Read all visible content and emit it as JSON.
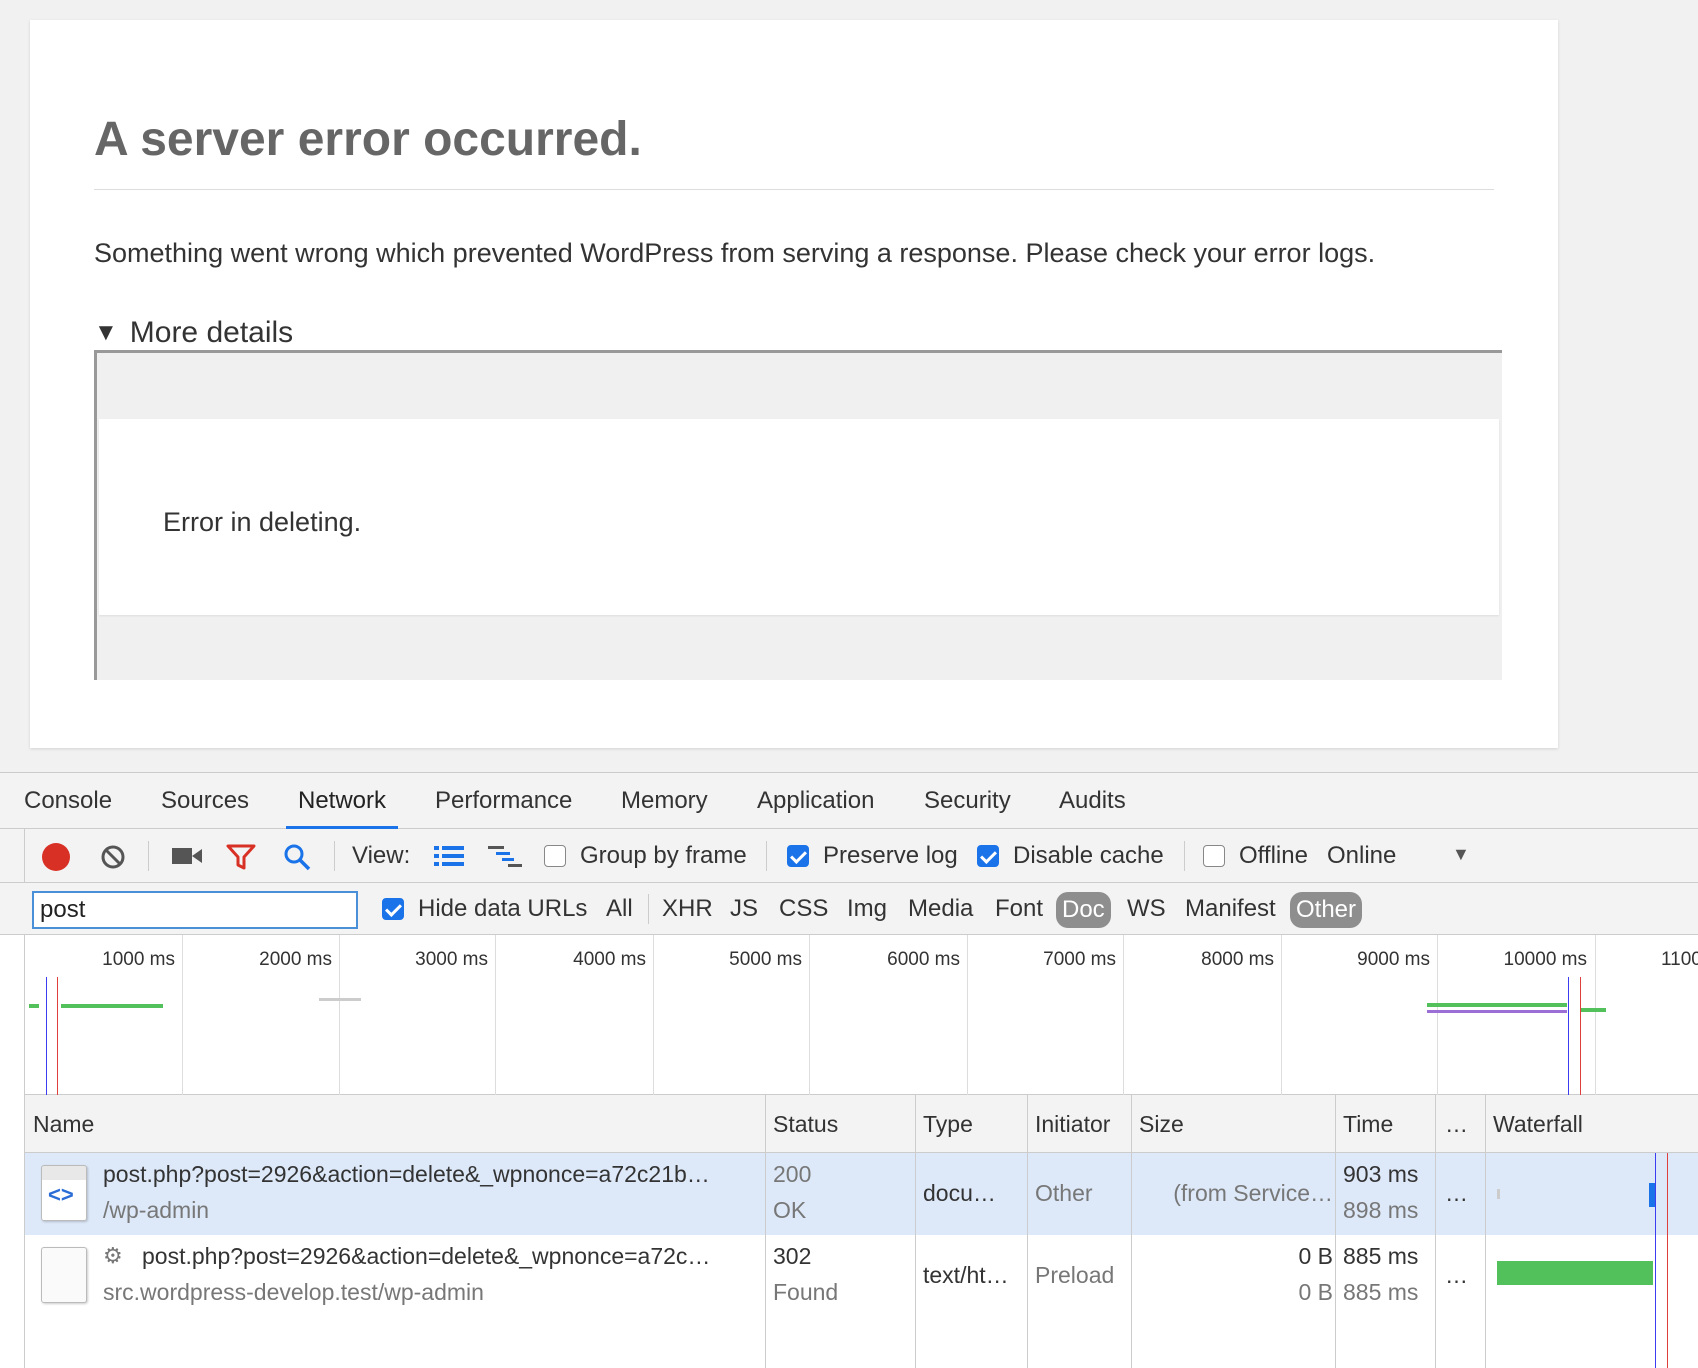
{
  "wp": {
    "title": "A server error occurred.",
    "message": "Something went wrong which prevented WordPress from serving a response. Please check your error logs.",
    "details_toggle": "More details",
    "frame_message": "Error in deleting."
  },
  "devtools": {
    "tabs": [
      {
        "label": "Console"
      },
      {
        "label": "Sources"
      },
      {
        "label": "Network",
        "active": true
      },
      {
        "label": "Performance"
      },
      {
        "label": "Memory"
      },
      {
        "label": "Application"
      },
      {
        "label": "Security"
      },
      {
        "label": "Audits"
      }
    ],
    "toolbar": {
      "view_label": "View:",
      "group_by_frame": {
        "label": "Group by frame",
        "checked": false
      },
      "preserve_log": {
        "label": "Preserve log",
        "checked": true
      },
      "disable_cache": {
        "label": "Disable cache",
        "checked": true
      },
      "offline": {
        "label": "Offline",
        "checked": false
      },
      "throttle_value": "Online"
    },
    "filter": {
      "value": "post",
      "hide_data_urls": {
        "label": "Hide data URLs",
        "checked": true
      },
      "types": [
        {
          "label": "All"
        },
        {
          "label": "XHR"
        },
        {
          "label": "JS"
        },
        {
          "label": "CSS"
        },
        {
          "label": "Img"
        },
        {
          "label": "Media"
        },
        {
          "label": "Font"
        },
        {
          "label": "Doc",
          "active": true
        },
        {
          "label": "WS"
        },
        {
          "label": "Manifest"
        },
        {
          "label": "Other",
          "active": true
        }
      ]
    },
    "overview": {
      "ticks": [
        "1000 ms",
        "2000 ms",
        "3000 ms",
        "4000 ms",
        "5000 ms",
        "6000 ms",
        "7000 ms",
        "8000 ms",
        "9000 ms",
        "10000 ms",
        "1100"
      ]
    },
    "table": {
      "columns": [
        "Name",
        "Status",
        "Type",
        "Initiator",
        "Size",
        "Time",
        "…",
        "Waterfall"
      ],
      "rows": [
        {
          "name": "post.php?post=2926&action=delete&_wpnonce=a72c21b…",
          "path": "/wp-admin",
          "status_code": "200",
          "status_text": "OK",
          "type": "docu…",
          "initiator": "Other",
          "size": "(from Service…",
          "time": "903 ms",
          "latency": "898 ms",
          "more": "…",
          "icon": "document-icon",
          "selected": true
        },
        {
          "name": "post.php?post=2926&action=delete&_wpnonce=a72c…",
          "path": "src.wordpress-develop.test/wp-admin",
          "status_code": "302",
          "status_text": "Found",
          "type": "text/ht…",
          "initiator": "Preload",
          "size": "0 B",
          "size_content": "0 B",
          "time": "885 ms",
          "latency": "885 ms",
          "more": "…",
          "icon": "blank-file-icon",
          "selected": false
        }
      ]
    }
  },
  "colors": {
    "record": "#d93025",
    "filter_icon": "#d93025",
    "accent": "#1a73e8",
    "waterfall_green": "#53c15b",
    "waterfall_blue": "#1a73e8",
    "dom_content_loaded_line": "#3c3cf0",
    "load_line": "#e0403b"
  }
}
